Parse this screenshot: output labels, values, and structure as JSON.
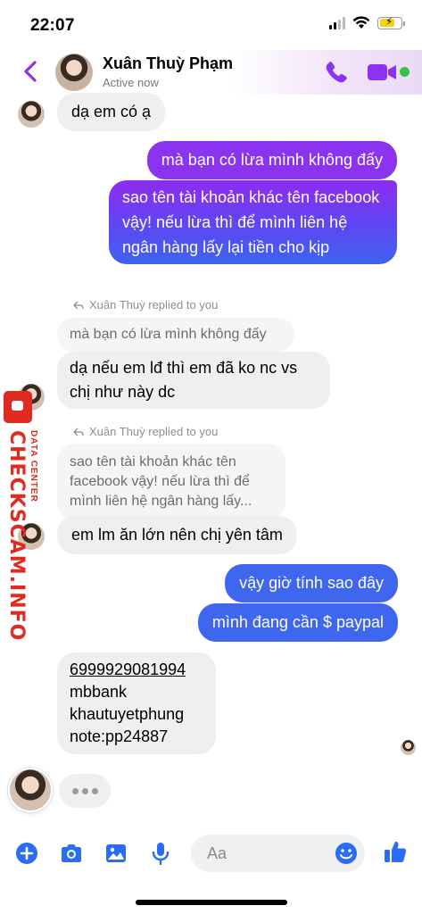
{
  "status_bar": {
    "time": "22:07"
  },
  "header": {
    "contact_name": "Xuân Thuỳ Phạm",
    "contact_status": "Active now"
  },
  "colors": {
    "accent": "#8a34ef",
    "outgoing_top": "#8f2cf0",
    "outgoing_bottom": "#3e63f0",
    "incoming": "#efefef",
    "online": "#33c24d",
    "watermark": "#e02b20"
  },
  "messages": [
    {
      "from": "contact",
      "text": "dạ em có ạ"
    },
    {
      "from": "me",
      "text": "mà bạn có lừa mình không đấy"
    },
    {
      "from": "me",
      "text": "sao tên tài khoản khác tên facebook vậy! nếu lừa thì để mình liên hệ ngân hàng lấy lại tiền cho kịp"
    },
    {
      "from": "contact",
      "reply_label": "Xuân Thuỳ replied to you",
      "quoted": "mà bạn có lừa mình không đấy",
      "text": "dạ nếu em lđ thì em đã ko nc vs chị như này dc"
    },
    {
      "from": "contact",
      "reply_label": "Xuân Thuỳ replied to you",
      "quoted": "sao tên tài khoản khác tên facebook vậy! nếu lừa thì để mình liên hệ ngân hàng lấy...",
      "text": "em lm ăn lớn nên chị yên tâm"
    },
    {
      "from": "me",
      "text": "vậy giờ tính sao đây"
    },
    {
      "from": "me",
      "text": "mình đang cần $ paypal"
    },
    {
      "from": "contact",
      "lines": [
        "6999929081994",
        "mbbank",
        "khautuyetphung",
        "note:pp24887"
      ]
    }
  ],
  "composer": {
    "placeholder": "Aa"
  },
  "watermark": {
    "brand": "CHECKSCAM.INFO",
    "tagline": "DATA CENTER"
  },
  "icons": [
    "back-chevron-icon",
    "phone-icon",
    "video-camera-icon",
    "plus-circle-icon",
    "camera-icon",
    "photo-icon",
    "microphone-icon",
    "emoji-icon",
    "thumbs-up-icon",
    "reply-arrow-icon"
  ]
}
